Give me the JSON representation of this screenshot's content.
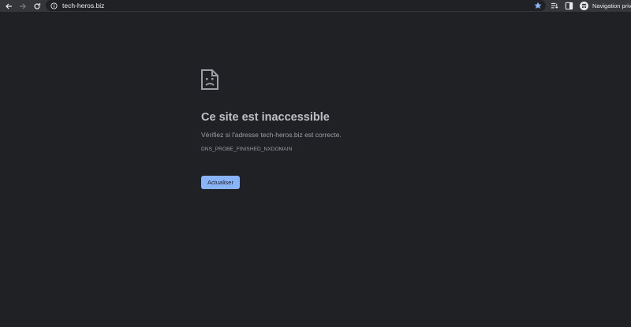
{
  "browser": {
    "url": "tech-heros.biz",
    "incognito_label": "Navigation privée"
  },
  "error": {
    "title": "Ce site est inaccessible",
    "message": "Vérifiez si l'adresse tech-heros.biz est correcte.",
    "code": "DNS_PROBE_FINISHED_NXDOMAIN",
    "reload_label": "Actualiser"
  },
  "colors": {
    "background": "#202124",
    "button": "#8ab4f8",
    "star": "#8ab4f8"
  }
}
